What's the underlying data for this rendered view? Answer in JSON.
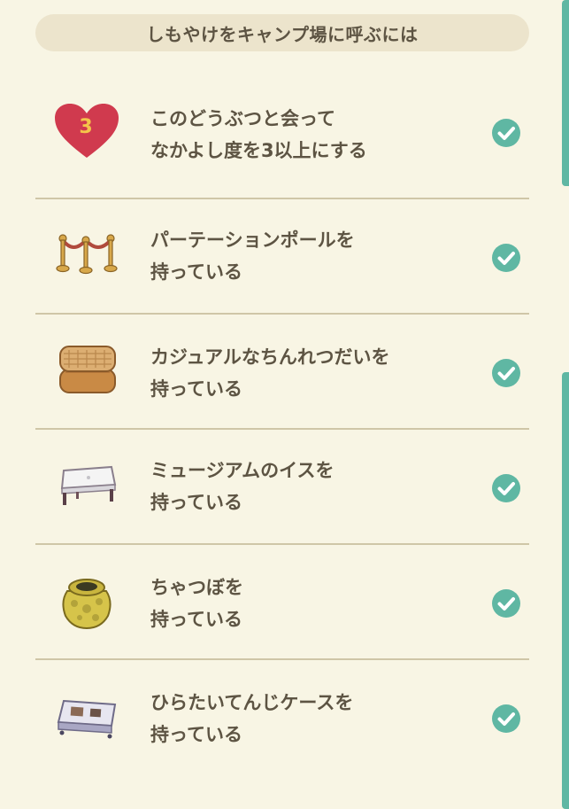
{
  "header": {
    "title": "しもやけをキャンプ場に呼ぶには"
  },
  "requirements": [
    {
      "line1": "このどうぶつと会って",
      "line2": "なかよし度を3以上にする",
      "icon": "heart-icon",
      "heart_level": "3",
      "completed": true
    },
    {
      "line1": "パーテーションポールを",
      "line2": "持っている",
      "icon": "partition-pole-icon",
      "completed": true
    },
    {
      "line1": "カジュアルなちんれつだいを",
      "line2": "持っている",
      "icon": "display-stand-icon",
      "completed": true
    },
    {
      "line1": "ミュージアムのイスを",
      "line2": "持っている",
      "icon": "museum-bench-icon",
      "completed": true
    },
    {
      "line1": "ちゃつぼを",
      "line2": "持っている",
      "icon": "tea-jar-icon",
      "completed": true
    },
    {
      "line1": "ひらたいてんじケースを",
      "line2": "持っている",
      "icon": "display-case-icon",
      "completed": true
    }
  ],
  "colors": {
    "background": "#f8f5e4",
    "header_pill": "#ece4cc",
    "check": "#5fb7a3",
    "heart": "#d03a4e",
    "heart_number": "#f4c54a",
    "text": "#5d5443",
    "divider": "#cfc6a7"
  }
}
